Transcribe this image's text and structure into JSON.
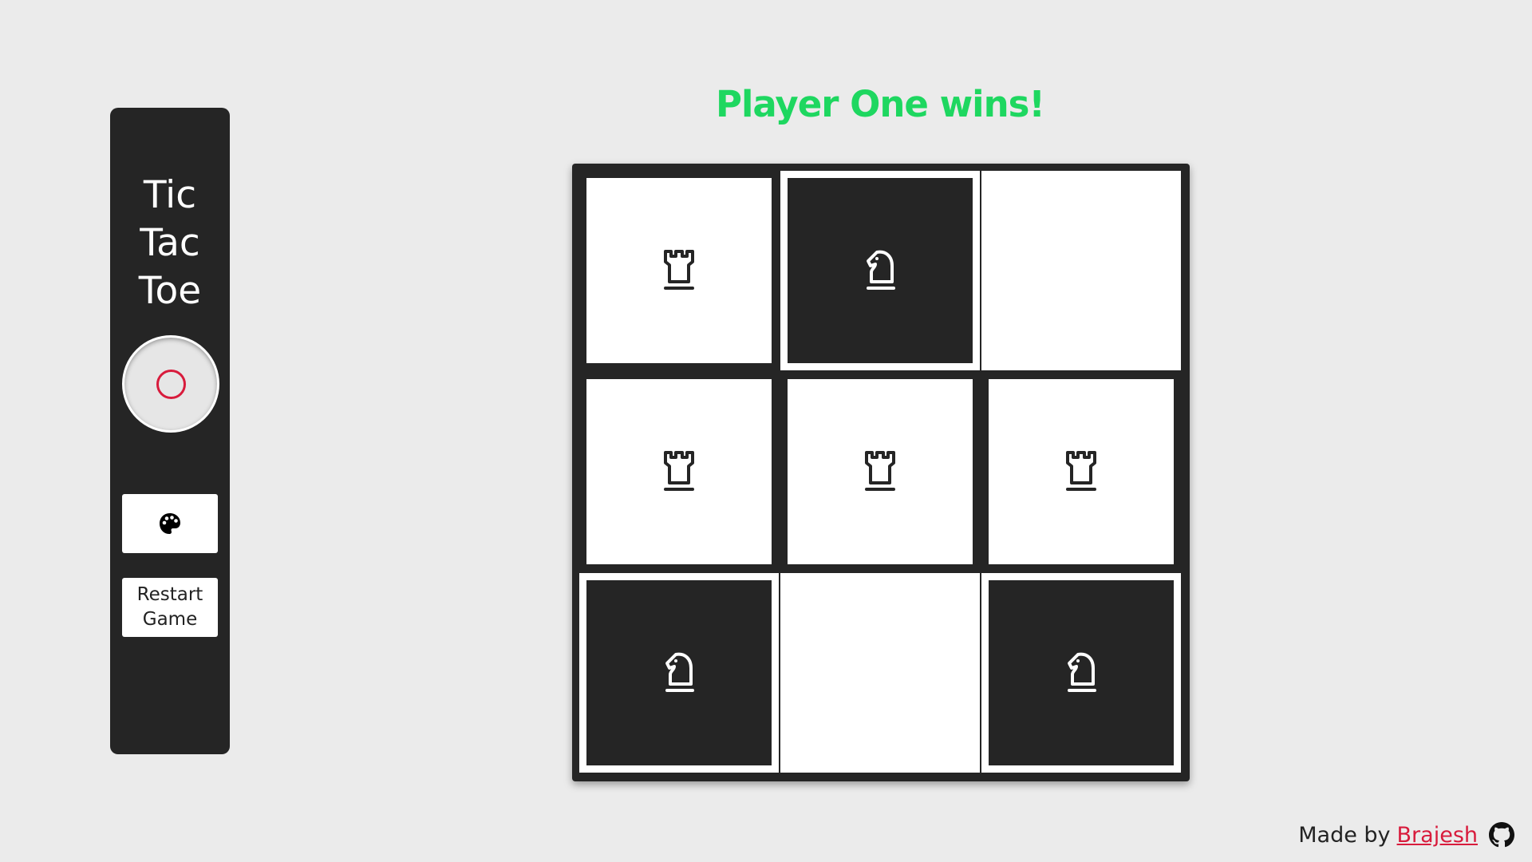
{
  "sidebar": {
    "title_lines": [
      "Tic",
      "Tac",
      "Toe"
    ],
    "current_turn_symbol": "circle",
    "theme_button_icon": "palette-icon",
    "restart_label_lines": [
      "Restart",
      "Game"
    ]
  },
  "status": {
    "message": "Player One wins!",
    "color": "#1ed760"
  },
  "board": {
    "cells": [
      {
        "row": 0,
        "col": 0,
        "piece": "rook",
        "style": "white"
      },
      {
        "row": 0,
        "col": 1,
        "piece": "knight",
        "style": "win-dark"
      },
      {
        "row": 0,
        "col": 2,
        "piece": "",
        "style": "win-white"
      },
      {
        "row": 1,
        "col": 0,
        "piece": "rook",
        "style": "white"
      },
      {
        "row": 1,
        "col": 1,
        "piece": "rook",
        "style": "white"
      },
      {
        "row": 1,
        "col": 2,
        "piece": "rook",
        "style": "white"
      },
      {
        "row": 2,
        "col": 0,
        "piece": "knight",
        "style": "win-dark"
      },
      {
        "row": 2,
        "col": 1,
        "piece": "",
        "style": "win-white"
      },
      {
        "row": 2,
        "col": 2,
        "piece": "knight",
        "style": "win-dark"
      }
    ]
  },
  "footer": {
    "made_by": "Made by",
    "author": "Brajesh",
    "icon": "github-icon"
  },
  "colors": {
    "background": "#ebebeb",
    "dark": "#252525",
    "accent_red": "#d81b3c",
    "win_green": "#1ed760"
  }
}
